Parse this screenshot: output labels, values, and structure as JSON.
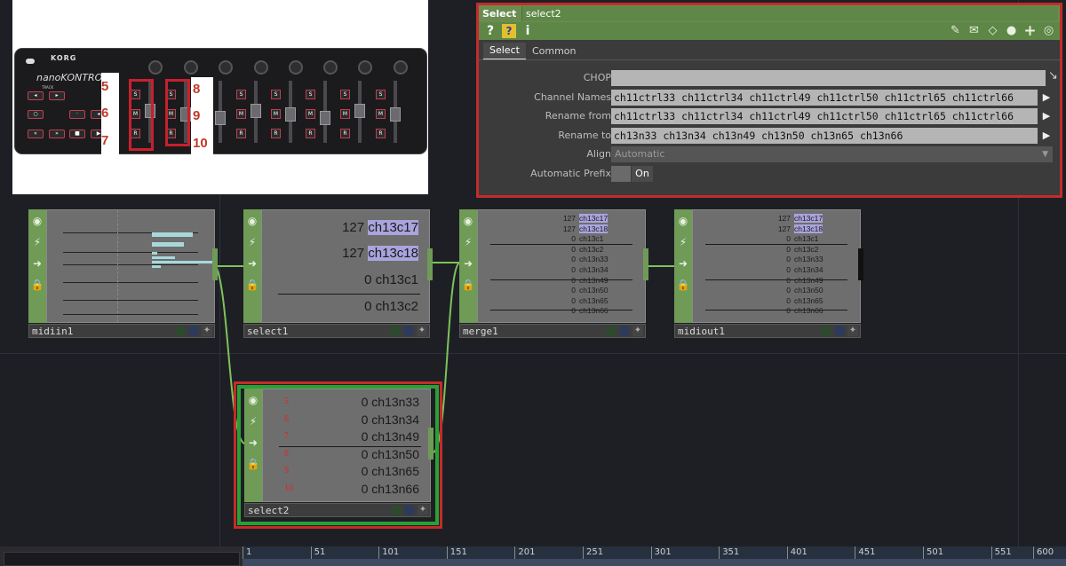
{
  "photo": {
    "brand": "KORG",
    "model": "nanoKONTROL",
    "annotations": [
      "5",
      "6",
      "7",
      "8",
      "9",
      "10"
    ],
    "strip_buttons": [
      "S",
      "M",
      "R"
    ]
  },
  "params": {
    "op_type": "Select",
    "op_name": "select2",
    "toolbar_left": [
      "?",
      "?",
      "i"
    ],
    "toolbar_right": [
      "pencil-icon",
      "comment-icon",
      "bookmark-icon",
      "python-icon",
      "add-icon",
      "target-icon"
    ],
    "tabs": [
      "Select",
      "Common"
    ],
    "rows": {
      "chop": {
        "label": "CHOP",
        "value": ""
      },
      "channel_names": {
        "label": "Channel Names",
        "value": "ch11ctrl33  ch11ctrl34  ch11ctrl49  ch11ctrl50  ch11ctrl65  ch11ctrl66"
      },
      "rename_from": {
        "label": "Rename from",
        "value": "ch11ctrl33  ch11ctrl34  ch11ctrl49  ch11ctrl50  ch11ctrl65  ch11ctrl66"
      },
      "rename_to": {
        "label": "Rename to",
        "value": "ch13n33  ch13n34  ch13n49  ch13n50  ch13n65  ch13n66"
      },
      "align": {
        "label": "Align",
        "value": "Automatic"
      },
      "auto_prefix": {
        "label": "Automatic Prefix",
        "value": "On"
      }
    }
  },
  "nodes": {
    "midiin1": {
      "name": "midiin1"
    },
    "select1": {
      "name": "select1",
      "channels": [
        {
          "value": "127",
          "name": "ch13c17"
        },
        {
          "value": "127",
          "name": "ch13c18"
        },
        {
          "value": "0",
          "name": "ch13c1"
        },
        {
          "value": "0",
          "name": "ch13c2"
        }
      ]
    },
    "merge1": {
      "name": "merge1",
      "channels": [
        {
          "value": "127",
          "name": "ch13c17"
        },
        {
          "value": "127",
          "name": "ch13c18"
        },
        {
          "value": "0",
          "name": "ch13c1"
        },
        {
          "value": "0",
          "name": "ch13c2"
        },
        {
          "value": "0",
          "name": "ch13n33"
        },
        {
          "value": "0",
          "name": "ch13n34"
        },
        {
          "value": "0",
          "name": "ch13n49"
        },
        {
          "value": "0",
          "name": "ch13n50"
        },
        {
          "value": "0",
          "name": "ch13n65"
        },
        {
          "value": "0",
          "name": "ch13n66"
        }
      ]
    },
    "midiout1": {
      "name": "midiout1",
      "channels": [
        {
          "value": "127",
          "name": "ch13c17"
        },
        {
          "value": "127",
          "name": "ch13c18"
        },
        {
          "value": "0",
          "name": "ch13c1"
        },
        {
          "value": "0",
          "name": "ch13c2"
        },
        {
          "value": "0",
          "name": "ch13n33"
        },
        {
          "value": "0",
          "name": "ch13n34"
        },
        {
          "value": "0",
          "name": "ch13n49"
        },
        {
          "value": "0",
          "name": "ch13n50"
        },
        {
          "value": "0",
          "name": "ch13n65"
        },
        {
          "value": "0",
          "name": "ch13n66"
        }
      ]
    },
    "select2": {
      "name": "select2",
      "index_labels": [
        "5",
        "6",
        "7",
        "8",
        "9",
        "10"
      ],
      "channels": [
        {
          "value": "0",
          "name": "ch13n33"
        },
        {
          "value": "0",
          "name": "ch13n34"
        },
        {
          "value": "0",
          "name": "ch13n49"
        },
        {
          "value": "0",
          "name": "ch13n50"
        },
        {
          "value": "0",
          "name": "ch13n65"
        },
        {
          "value": "0",
          "name": "ch13n66"
        }
      ]
    }
  },
  "timeline": {
    "ticks": [
      "1",
      "51",
      "101",
      "151",
      "201",
      "251",
      "301",
      "351",
      "401",
      "451",
      "501",
      "551",
      "600"
    ]
  },
  "colors": {
    "operator_green": "#6f9b57",
    "selection_red": "#c42b2b",
    "selected_green": "#2aa035",
    "highlight": "#a9a4dd"
  }
}
